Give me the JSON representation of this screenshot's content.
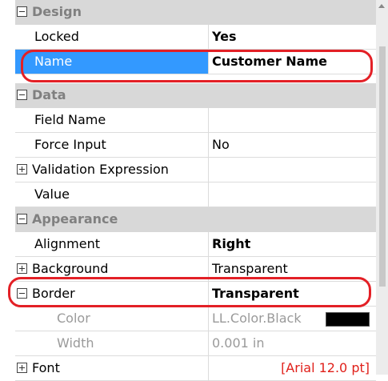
{
  "categories": {
    "design": "Design",
    "data": "Data",
    "appearance": "Appearance"
  },
  "rows": {
    "locked": {
      "name": "Locked",
      "value": "Yes"
    },
    "name": {
      "name": "Name",
      "value": "Customer Name"
    },
    "field_name": {
      "name": "Field Name",
      "value": ""
    },
    "force_input": {
      "name": "Force Input",
      "value": "No"
    },
    "validation_expression": {
      "name": "Validation Expression",
      "value": ""
    },
    "value": {
      "name": "Value",
      "value": ""
    },
    "alignment": {
      "name": "Alignment",
      "value": "Right"
    },
    "background": {
      "name": "Background",
      "value": "Transparent"
    },
    "border": {
      "name": "Border",
      "value": "Transparent"
    },
    "color": {
      "name": "Color",
      "value": "LL.Color.Black"
    },
    "width": {
      "name": "Width",
      "value": "0.001 in"
    },
    "font": {
      "name": "Font",
      "value": "[Arial 12.0 pt]"
    }
  },
  "colors": {
    "selection": "#3399ff",
    "category_background": "#d8d8d8",
    "highlight_red": "#e32026",
    "font_value_red": "#e0201a",
    "swatch": "#000000"
  },
  "icons": {
    "expanded": "collapse-minus-icon",
    "collapsed": "expand-plus-icon"
  }
}
